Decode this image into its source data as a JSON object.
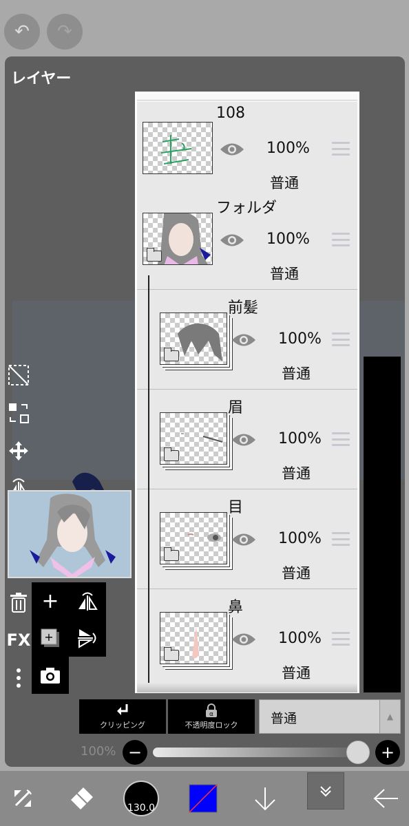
{
  "toolbar": {
    "undo_icon": "undo-icon",
    "redo_icon": "redo-icon"
  },
  "panel": {
    "title": "レイヤー"
  },
  "layers": [
    {
      "name": "108",
      "opacity": "100%",
      "blend": "普通",
      "type": "layer"
    },
    {
      "name": "フォルダ",
      "opacity": "100%",
      "blend": "普通",
      "type": "folder"
    },
    {
      "name": "前髪",
      "opacity": "100%",
      "blend": "普通",
      "type": "folder"
    },
    {
      "name": "眉",
      "opacity": "100%",
      "blend": "普通",
      "type": "folder"
    },
    {
      "name": "目",
      "opacity": "100%",
      "blend": "普通",
      "type": "folder"
    },
    {
      "name": "鼻",
      "opacity": "100%",
      "blend": "普通",
      "type": "folder"
    }
  ],
  "side_tools": [
    "select-icon",
    "swap-icon",
    "move-icon",
    "flip-horizontal-icon",
    "flip-vertical-icon",
    "merge-down-icon",
    "trash-icon",
    "fx-button",
    "more-icon"
  ],
  "side_fx_label": "FX",
  "controls": {
    "clipping_label": "クリッピング",
    "alpha_lock_label": "不透明度ロック",
    "blend_mode": "普通",
    "opacity_label": "100%",
    "opacity_value": 1.0
  },
  "bottom": {
    "brush_size": "130.0",
    "color": "#0000ff"
  },
  "colors": {
    "panel": "#5e5e5e",
    "list": "#e8e8e8",
    "accent": "#0000ff"
  }
}
